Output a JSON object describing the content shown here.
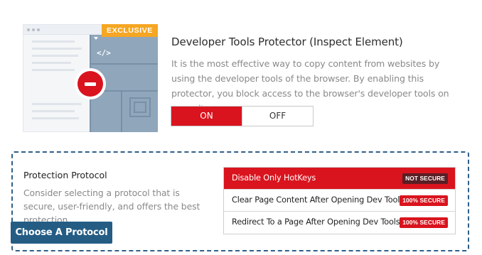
{
  "feature": {
    "badge": "EXCLUSIVE",
    "code_glyph": "</>",
    "title": "Developer Tools Protector (Inspect Element)",
    "description": "It is the most effective way to copy content from websites by using the developer tools of the browser. By enabling this protector, you block access to the browser's developer tools on your site.",
    "toggle": {
      "on_label": "ON",
      "off_label": "OFF",
      "selected": "ON"
    }
  },
  "protection": {
    "title": "Protection Protocol",
    "description": "Consider selecting a protocol that is secure, user-friendly, and offers the best protection.",
    "button_label": "Choose A Protocol",
    "options": [
      {
        "label": "Disable Only HotKeys",
        "tag": "NOT SECURE",
        "selected": true
      },
      {
        "label": "Clear Page Content After Opening Dev Tools",
        "tag": "100% SECURE",
        "selected": false
      },
      {
        "label": "Redirect To a Page After Opening Dev Tools",
        "tag": "100% SECURE",
        "selected": false
      }
    ]
  },
  "colors": {
    "accent_red": "#d9141e",
    "badge_orange": "#f5a623",
    "primary_blue": "#245c84",
    "dark_tag": "#5a1e25"
  }
}
